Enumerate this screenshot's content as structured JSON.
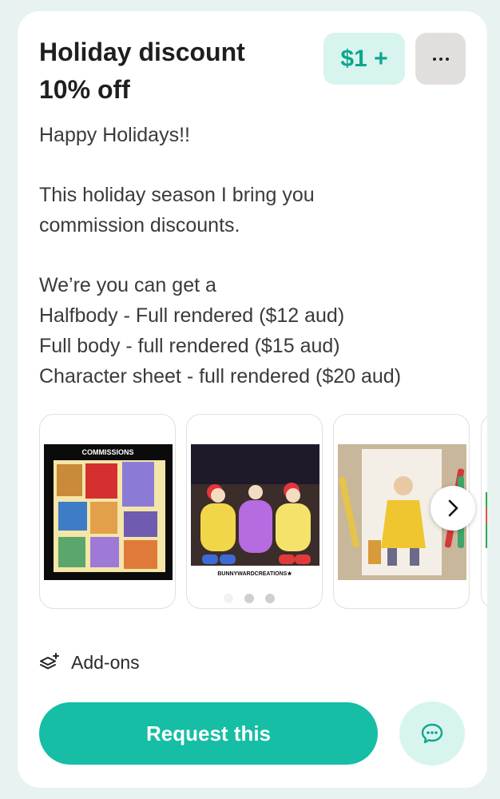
{
  "listing": {
    "title_line1": "Holiday discount",
    "title_line2": "10% off",
    "price_label": "$1 +",
    "more_label": "...",
    "description": {
      "l1": "Happy Holidays!!",
      "l2": "",
      "l3": "This holiday season I bring you",
      "l4": "commission discounts.",
      "l5": "",
      "l6": "We’re you can get a",
      "l7": "Halfbody - Full rendered ($12 aud)",
      "l8": "Full body - full rendered ($15 aud)",
      "l9": "Character sheet - full rendered ($20 aud)"
    }
  },
  "gallery": {
    "image1_caption": "COMMISSIONS",
    "image2_caption": "BUNNYWARDCREATIONS★",
    "page_count": 3,
    "active_page": 1
  },
  "addons": {
    "label": "Add-ons"
  },
  "actions": {
    "request_label": "Request this"
  },
  "colors": {
    "accent": "#15bea4",
    "accent_light": "#d8f4ee",
    "background": "#e8f2f0"
  },
  "icons": {
    "more": "more-dots-icon",
    "next": "chevron-right-icon",
    "addons": "layers-plus-icon",
    "chat": "chat-bubble-icon"
  }
}
